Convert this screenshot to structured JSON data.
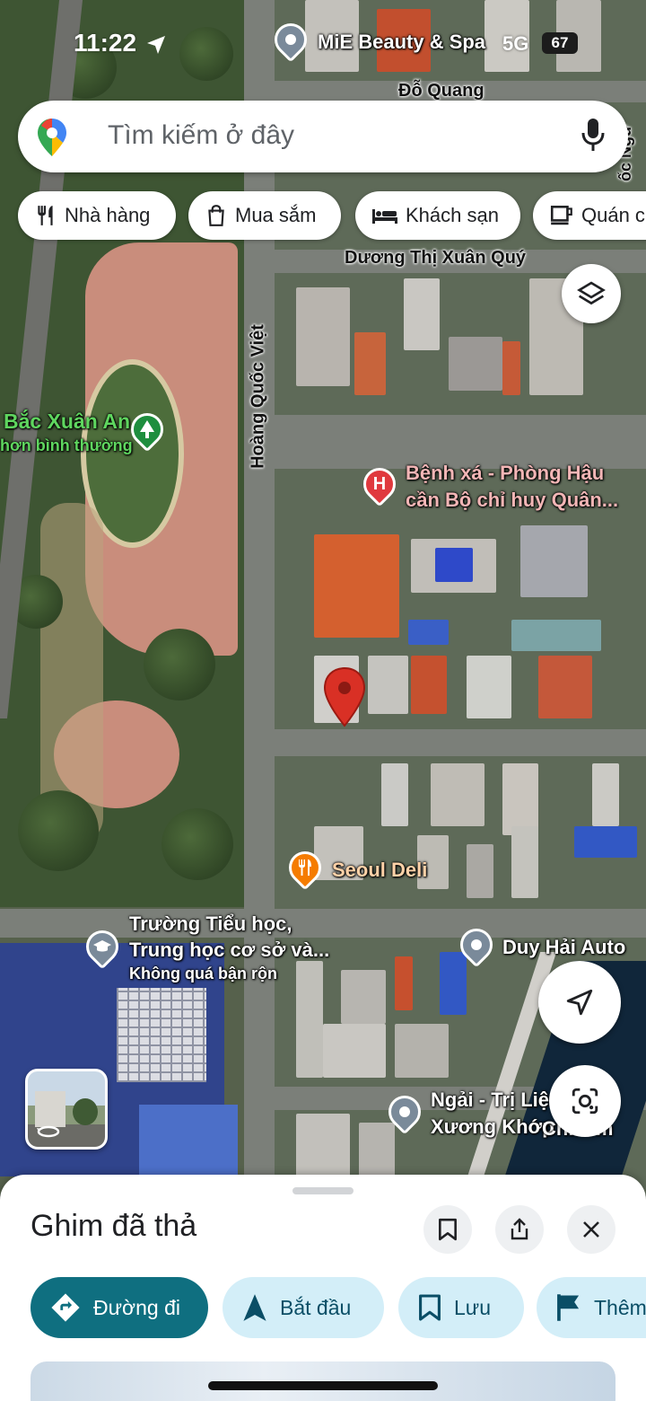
{
  "status_bar": {
    "time": "11:22",
    "network": "5G",
    "battery": "67"
  },
  "search": {
    "placeholder": "Tìm kiếm ở đây"
  },
  "chips": [
    {
      "label": "Nhà hàng",
      "icon": "fork-knife-icon"
    },
    {
      "label": "Mua sắm",
      "icon": "shopping-bag-icon"
    },
    {
      "label": "Khách sạn",
      "icon": "bed-icon"
    },
    {
      "label": "Quán c",
      "icon": "coffee-icon"
    }
  ],
  "map": {
    "roads": {
      "do_quang": "Đỗ Quang",
      "duong_thi_xuan_quy": "Dương Thị Xuân Quý",
      "hoang_quoc_viet": "Hoàng Quốc Việt",
      "edge_right": "ốc Ngữ"
    },
    "places": {
      "mie_beauty": "MiE Beauty & Spa",
      "park_name": "Bắc Xuân An",
      "park_status": "hơn bình thường",
      "hospital_line1": "Bệnh xá - Phòng Hậu",
      "hospital_line2": "cần Bộ chỉ huy Quân...",
      "seoul_deli": "Seoul Deli",
      "school_line1": "Trường Tiểu học,",
      "school_line2": "Trung học cơ sở và...",
      "school_status": "Không quá bận rộn",
      "duy_hai": "Duy Hải Auto",
      "ngai_line1": "Ngải - Trị Liệu",
      "ngai_line2": "Xương Khớp",
      "ch_em": "Ch...em"
    },
    "dropped_pin_color": "#d93025"
  },
  "sheet": {
    "title": "Ghim đã thả",
    "actions": [
      {
        "label": "Đường đi"
      },
      {
        "label": "Bắt đầu"
      },
      {
        "label": "Lưu"
      },
      {
        "label": "Thêm"
      }
    ]
  },
  "colors": {
    "primary": "#0f6f80",
    "secondary": "#d3eef8",
    "pin": "#d93025"
  }
}
